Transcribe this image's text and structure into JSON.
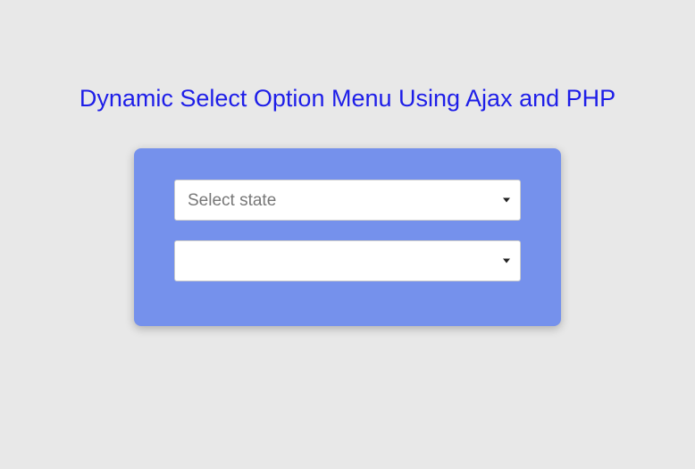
{
  "page": {
    "title": "Dynamic Select Option Menu Using Ajax and PHP"
  },
  "form": {
    "state_select": {
      "placeholder": "Select state",
      "selected": "Select state"
    },
    "city_select": {
      "placeholder": "",
      "selected": ""
    }
  }
}
